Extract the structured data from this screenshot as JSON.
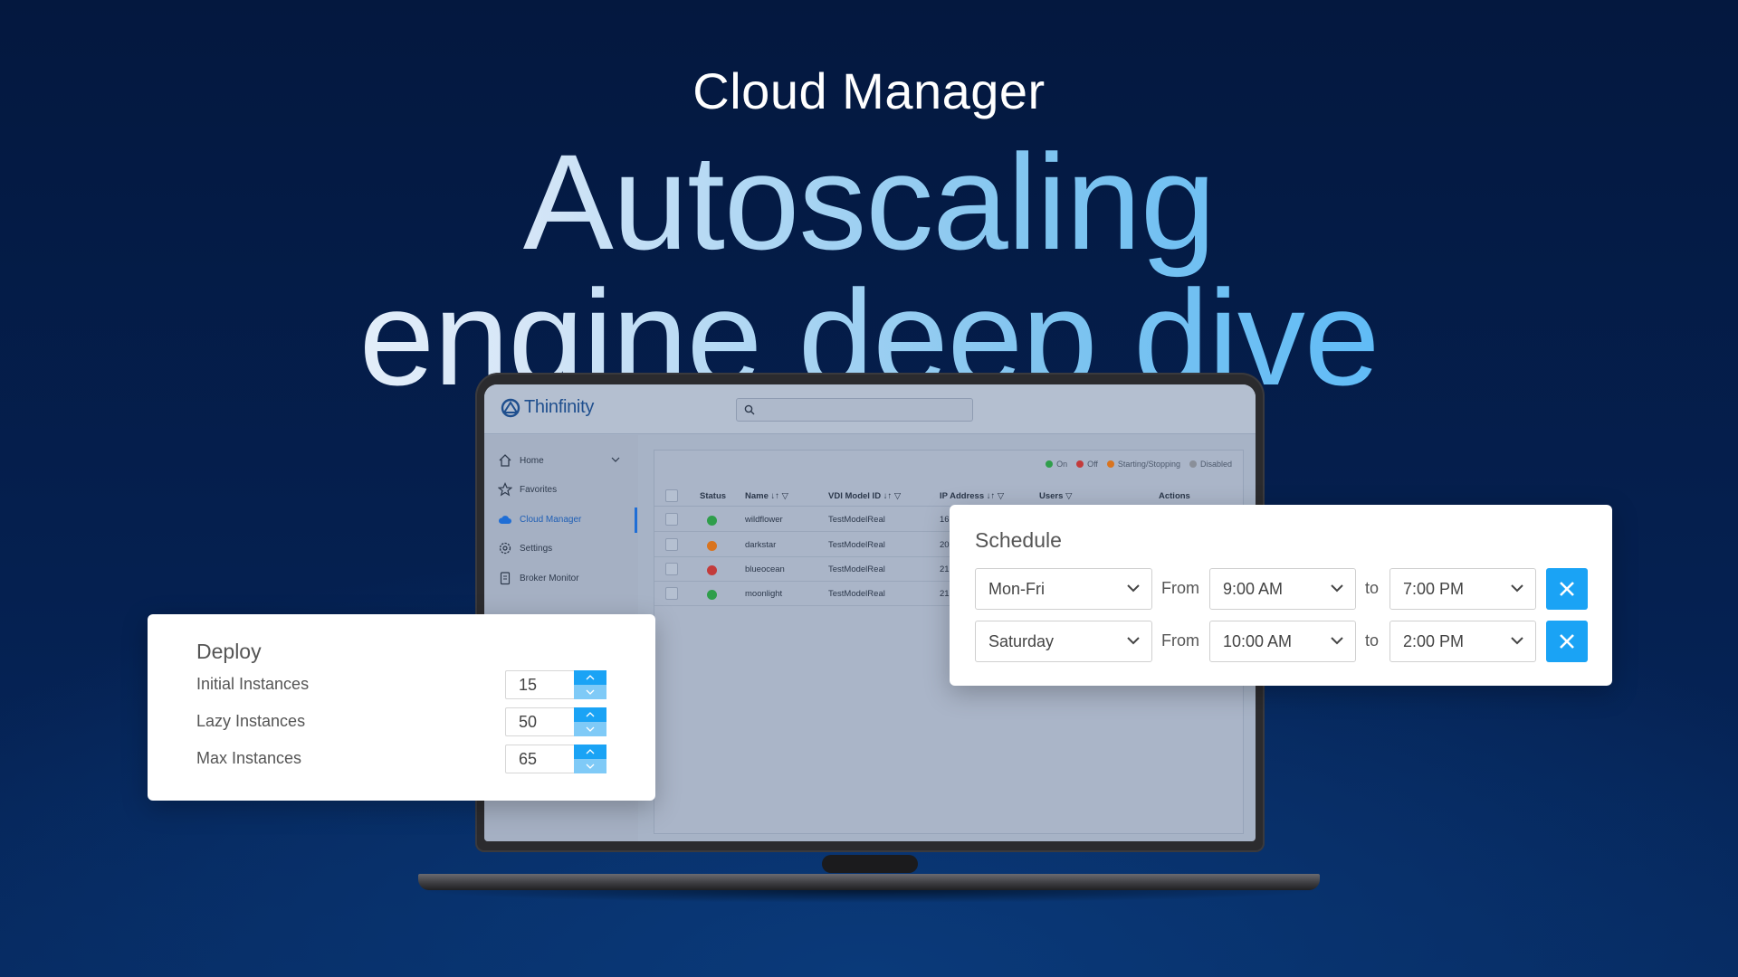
{
  "hero": {
    "eyebrow": "Cloud Manager",
    "headline_line1": "Autoscaling",
    "headline_line2": "engine deep dive"
  },
  "app": {
    "brand": "Thinfinity",
    "search_placeholder": "",
    "sidebar": {
      "items": [
        {
          "label": "Home",
          "icon": "home-icon"
        },
        {
          "label": "Favorites",
          "icon": "star-icon"
        },
        {
          "label": "Cloud Manager",
          "icon": "cloud-icon",
          "active": true
        },
        {
          "label": "Settings",
          "icon": "gear-icon"
        },
        {
          "label": "Broker Monitor",
          "icon": "clipboard-icon"
        }
      ]
    },
    "legend": {
      "on": "On",
      "off": "Off",
      "starting": "Starting/Stopping",
      "disabled": "Disabled",
      "colors": {
        "on": "#2f9e4b",
        "off": "#c33b3b",
        "starting": "#d9741f",
        "disabled": "#8a8f99"
      }
    },
    "table": {
      "headers": {
        "status": "Status",
        "name": "Name",
        "vdi": "VDI Model ID",
        "ip": "IP Address",
        "users": "Users",
        "actions": "Actions"
      },
      "rows": [
        {
          "status": "on",
          "name": "wildflower",
          "vdi": "TestModelReal",
          "ip": "16"
        },
        {
          "status": "starting",
          "name": "darkstar",
          "vdi": "TestModelReal",
          "ip": "20"
        },
        {
          "status": "off",
          "name": "blueocean",
          "vdi": "TestModelReal",
          "ip": "21"
        },
        {
          "status": "on",
          "name": "moonlight",
          "vdi": "TestModelReal",
          "ip": "21"
        }
      ]
    }
  },
  "deploy": {
    "title": "Deploy",
    "rows": [
      {
        "label": "Initial Instances",
        "value": "15"
      },
      {
        "label": "Lazy Instances",
        "value": "50"
      },
      {
        "label": "Max Instances",
        "value": "65"
      }
    ]
  },
  "schedule": {
    "title": "Schedule",
    "from_label": "From",
    "to_label": "to",
    "rows": [
      {
        "days": "Mon-Fri",
        "from": "9:00 AM",
        "to": "7:00 PM"
      },
      {
        "days": "Saturday",
        "from": "10:00 AM",
        "to": "2:00 PM"
      }
    ]
  },
  "colors": {
    "accent": "#1aa3f5",
    "background": "#04183f"
  }
}
